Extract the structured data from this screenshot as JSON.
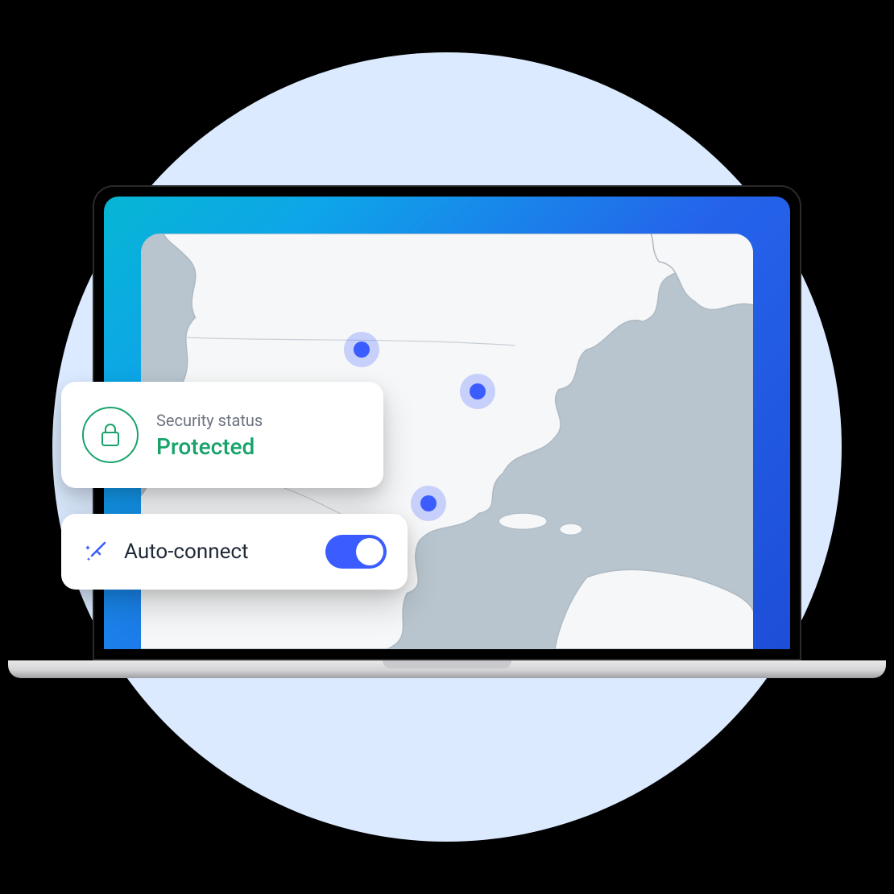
{
  "colors": {
    "accent_blue": "#3b5cff",
    "success_green": "#17a36a",
    "bg_circle": "#dbeafe",
    "water": "#b8c5ce",
    "land": "#f6f7f8"
  },
  "map": {
    "region": "North America",
    "markers": [
      {
        "name": "server-location-northwest-us"
      },
      {
        "name": "server-location-central-us"
      },
      {
        "name": "server-location-mexico"
      }
    ]
  },
  "status_card": {
    "icon": "lock-icon",
    "label": "Security status",
    "value": "Protected"
  },
  "auto_connect_card": {
    "icon": "magic-wand-icon",
    "label": "Auto-connect",
    "toggle_on": true
  }
}
